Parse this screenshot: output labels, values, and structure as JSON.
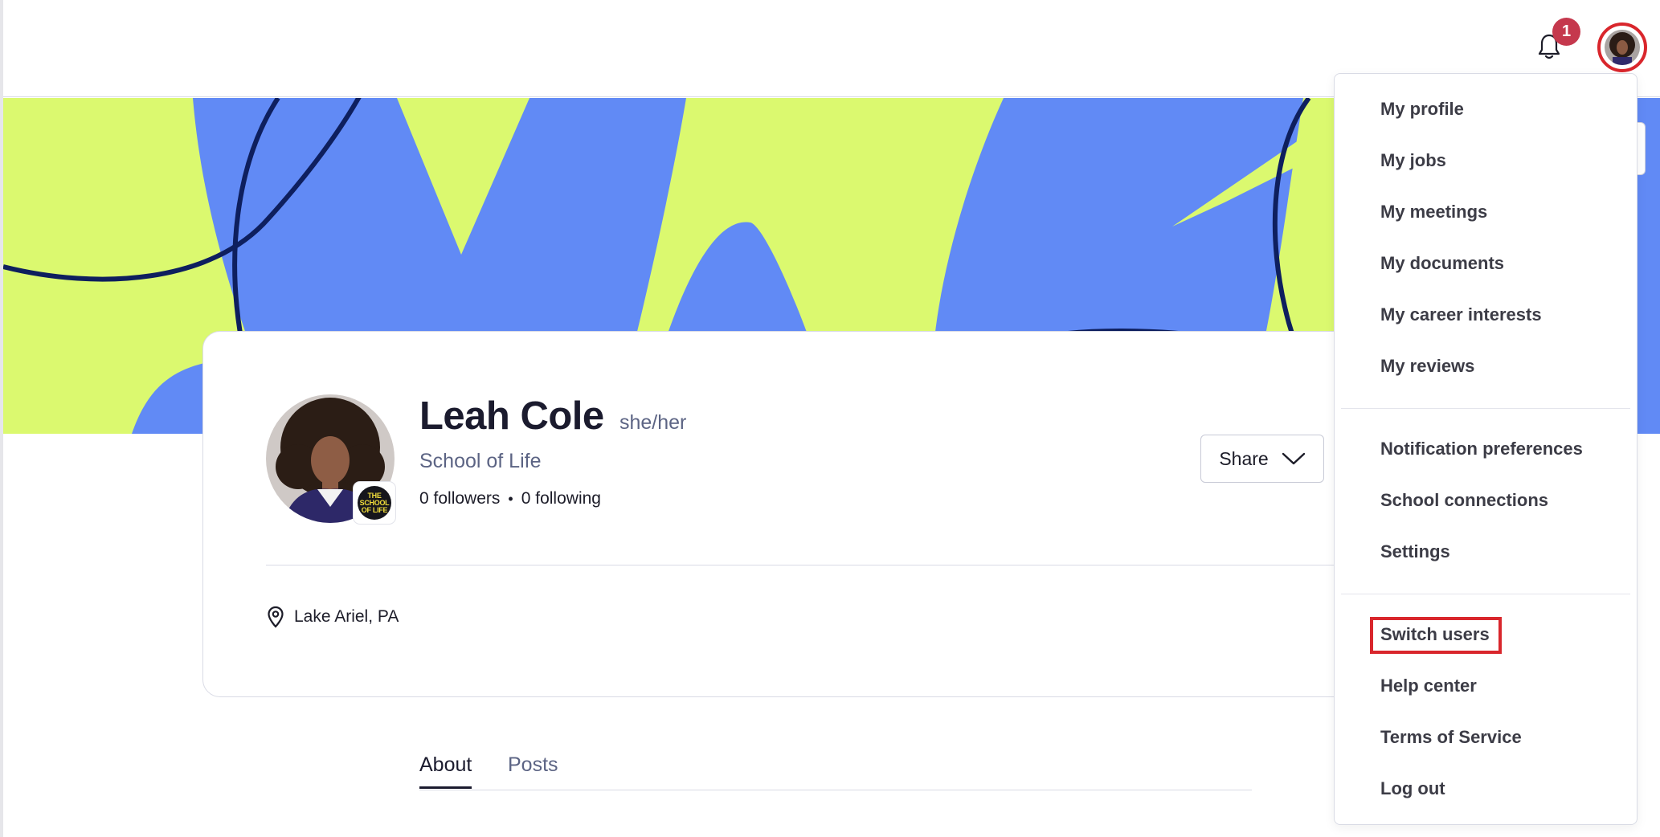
{
  "header": {
    "notification_count": "1",
    "notification_icon": "bell-icon",
    "avatar_icon": "user-avatar"
  },
  "profile": {
    "name": "Leah Cole",
    "pronouns": "she/her",
    "school": "School of Life",
    "followers_count": "0",
    "followers_label": "followers",
    "separator": "•",
    "following_count": "0",
    "following_label": "following",
    "location": "Lake Ariel, PA",
    "school_logo_lines": [
      "THE",
      "SCHOOL",
      "OF LIFE"
    ],
    "share_label": "Share"
  },
  "tabs": [
    {
      "label": "About",
      "active": true
    },
    {
      "label": "Posts",
      "active": false
    }
  ],
  "menu": {
    "group1": [
      "My profile",
      "My jobs",
      "My meetings",
      "My documents",
      "My career interests",
      "My reviews"
    ],
    "group2": [
      "Notification preferences",
      "School connections",
      "Settings"
    ],
    "group3": [
      "Switch users",
      "Help center",
      "Terms of Service",
      "Log out"
    ],
    "highlighted_item": "Switch users"
  },
  "colors": {
    "banner_green": "#dbf96f",
    "banner_blue": "#618af5",
    "banner_line": "#0e1f5e",
    "badge_red": "#c5384d",
    "highlight_red": "#d9262c",
    "muted_text": "#5c6484"
  }
}
